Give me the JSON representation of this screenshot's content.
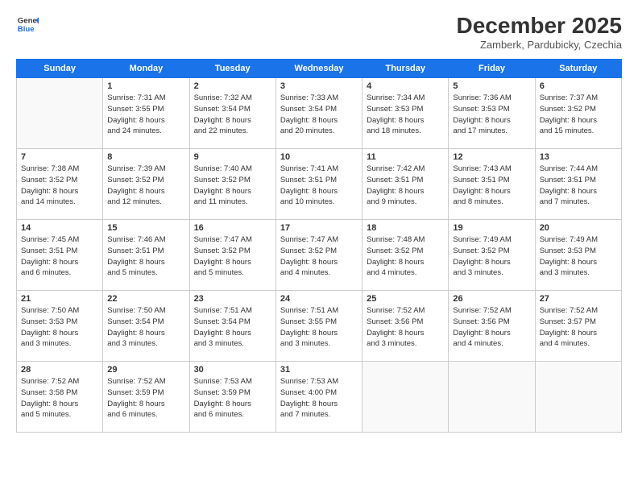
{
  "header": {
    "logo_line1": "General",
    "logo_line2": "Blue",
    "month": "December 2025",
    "location": "Zamberk, Pardubicky, Czechia"
  },
  "days_of_week": [
    "Sunday",
    "Monday",
    "Tuesday",
    "Wednesday",
    "Thursday",
    "Friday",
    "Saturday"
  ],
  "weeks": [
    [
      {
        "day": "",
        "info": ""
      },
      {
        "day": "1",
        "info": "Sunrise: 7:31 AM\nSunset: 3:55 PM\nDaylight: 8 hours\nand 24 minutes."
      },
      {
        "day": "2",
        "info": "Sunrise: 7:32 AM\nSunset: 3:54 PM\nDaylight: 8 hours\nand 22 minutes."
      },
      {
        "day": "3",
        "info": "Sunrise: 7:33 AM\nSunset: 3:54 PM\nDaylight: 8 hours\nand 20 minutes."
      },
      {
        "day": "4",
        "info": "Sunrise: 7:34 AM\nSunset: 3:53 PM\nDaylight: 8 hours\nand 18 minutes."
      },
      {
        "day": "5",
        "info": "Sunrise: 7:36 AM\nSunset: 3:53 PM\nDaylight: 8 hours\nand 17 minutes."
      },
      {
        "day": "6",
        "info": "Sunrise: 7:37 AM\nSunset: 3:52 PM\nDaylight: 8 hours\nand 15 minutes."
      }
    ],
    [
      {
        "day": "7",
        "info": "Sunrise: 7:38 AM\nSunset: 3:52 PM\nDaylight: 8 hours\nand 14 minutes."
      },
      {
        "day": "8",
        "info": "Sunrise: 7:39 AM\nSunset: 3:52 PM\nDaylight: 8 hours\nand 12 minutes."
      },
      {
        "day": "9",
        "info": "Sunrise: 7:40 AM\nSunset: 3:52 PM\nDaylight: 8 hours\nand 11 minutes."
      },
      {
        "day": "10",
        "info": "Sunrise: 7:41 AM\nSunset: 3:51 PM\nDaylight: 8 hours\nand 10 minutes."
      },
      {
        "day": "11",
        "info": "Sunrise: 7:42 AM\nSunset: 3:51 PM\nDaylight: 8 hours\nand 9 minutes."
      },
      {
        "day": "12",
        "info": "Sunrise: 7:43 AM\nSunset: 3:51 PM\nDaylight: 8 hours\nand 8 minutes."
      },
      {
        "day": "13",
        "info": "Sunrise: 7:44 AM\nSunset: 3:51 PM\nDaylight: 8 hours\nand 7 minutes."
      }
    ],
    [
      {
        "day": "14",
        "info": "Sunrise: 7:45 AM\nSunset: 3:51 PM\nDaylight: 8 hours\nand 6 minutes."
      },
      {
        "day": "15",
        "info": "Sunrise: 7:46 AM\nSunset: 3:51 PM\nDaylight: 8 hours\nand 5 minutes."
      },
      {
        "day": "16",
        "info": "Sunrise: 7:47 AM\nSunset: 3:52 PM\nDaylight: 8 hours\nand 5 minutes."
      },
      {
        "day": "17",
        "info": "Sunrise: 7:47 AM\nSunset: 3:52 PM\nDaylight: 8 hours\nand 4 minutes."
      },
      {
        "day": "18",
        "info": "Sunrise: 7:48 AM\nSunset: 3:52 PM\nDaylight: 8 hours\nand 4 minutes."
      },
      {
        "day": "19",
        "info": "Sunrise: 7:49 AM\nSunset: 3:52 PM\nDaylight: 8 hours\nand 3 minutes."
      },
      {
        "day": "20",
        "info": "Sunrise: 7:49 AM\nSunset: 3:53 PM\nDaylight: 8 hours\nand 3 minutes."
      }
    ],
    [
      {
        "day": "21",
        "info": "Sunrise: 7:50 AM\nSunset: 3:53 PM\nDaylight: 8 hours\nand 3 minutes."
      },
      {
        "day": "22",
        "info": "Sunrise: 7:50 AM\nSunset: 3:54 PM\nDaylight: 8 hours\nand 3 minutes."
      },
      {
        "day": "23",
        "info": "Sunrise: 7:51 AM\nSunset: 3:54 PM\nDaylight: 8 hours\nand 3 minutes."
      },
      {
        "day": "24",
        "info": "Sunrise: 7:51 AM\nSunset: 3:55 PM\nDaylight: 8 hours\nand 3 minutes."
      },
      {
        "day": "25",
        "info": "Sunrise: 7:52 AM\nSunset: 3:56 PM\nDaylight: 8 hours\nand 3 minutes."
      },
      {
        "day": "26",
        "info": "Sunrise: 7:52 AM\nSunset: 3:56 PM\nDaylight: 8 hours\nand 4 minutes."
      },
      {
        "day": "27",
        "info": "Sunrise: 7:52 AM\nSunset: 3:57 PM\nDaylight: 8 hours\nand 4 minutes."
      }
    ],
    [
      {
        "day": "28",
        "info": "Sunrise: 7:52 AM\nSunset: 3:58 PM\nDaylight: 8 hours\nand 5 minutes."
      },
      {
        "day": "29",
        "info": "Sunrise: 7:52 AM\nSunset: 3:59 PM\nDaylight: 8 hours\nand 6 minutes."
      },
      {
        "day": "30",
        "info": "Sunrise: 7:53 AM\nSunset: 3:59 PM\nDaylight: 8 hours\nand 6 minutes."
      },
      {
        "day": "31",
        "info": "Sunrise: 7:53 AM\nSunset: 4:00 PM\nDaylight: 8 hours\nand 7 minutes."
      },
      {
        "day": "",
        "info": ""
      },
      {
        "day": "",
        "info": ""
      },
      {
        "day": "",
        "info": ""
      }
    ]
  ]
}
